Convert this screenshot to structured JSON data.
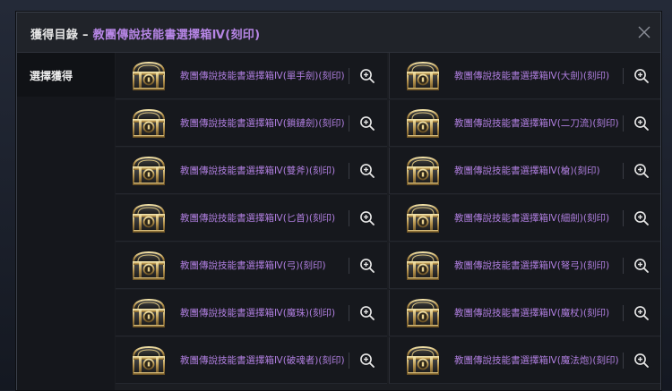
{
  "header": {
    "title_prefix": "獲得目錄 – ",
    "title_item": "教團傳說技能書選擇箱Ⅳ(刻印)"
  },
  "sidebar": {
    "tab_label": "選擇獲得"
  },
  "colors": {
    "accent": "#b786e6",
    "item_name": "#b07fe0",
    "panel_bg": "#1b1d22"
  },
  "items": [
    {
      "name": "教團傳說技能書選擇箱Ⅳ(單手劍)(刻印)",
      "icon": "treasure-chest-icon"
    },
    {
      "name": "教團傳說技能書選擇箱Ⅳ(大劍)(刻印)",
      "icon": "treasure-chest-icon"
    },
    {
      "name": "教團傳說技能書選擇箱Ⅳ(鎖鏈劍)(刻印)",
      "icon": "treasure-chest-icon"
    },
    {
      "name": "教團傳說技能書選擇箱Ⅳ(二刀流)(刻印)",
      "icon": "treasure-chest-icon"
    },
    {
      "name": "教團傳說技能書選擇箱Ⅳ(雙斧)(刻印)",
      "icon": "treasure-chest-icon"
    },
    {
      "name": "教團傳說技能書選擇箱Ⅳ(槍)(刻印)",
      "icon": "treasure-chest-icon"
    },
    {
      "name": "教團傳說技能書選擇箱Ⅳ(匕首)(刻印)",
      "icon": "treasure-chest-icon"
    },
    {
      "name": "教團傳說技能書選擇箱Ⅳ(細劍)(刻印)",
      "icon": "treasure-chest-icon"
    },
    {
      "name": "教團傳說技能書選擇箱Ⅳ(弓)(刻印)",
      "icon": "treasure-chest-icon"
    },
    {
      "name": "教團傳說技能書選擇箱Ⅳ(弩弓)(刻印)",
      "icon": "treasure-chest-icon"
    },
    {
      "name": "教團傳說技能書選擇箱Ⅳ(魔珠)(刻印)",
      "icon": "treasure-chest-icon"
    },
    {
      "name": "教團傳說技能書選擇箱Ⅳ(魔杖)(刻印)",
      "icon": "treasure-chest-icon"
    },
    {
      "name": "教團傳說技能書選擇箱Ⅳ(破魂者)(刻印)",
      "icon": "treasure-chest-icon"
    },
    {
      "name": "教團傳說技能書選擇箱Ⅳ(魔法炮)(刻印)",
      "icon": "treasure-chest-icon"
    }
  ]
}
